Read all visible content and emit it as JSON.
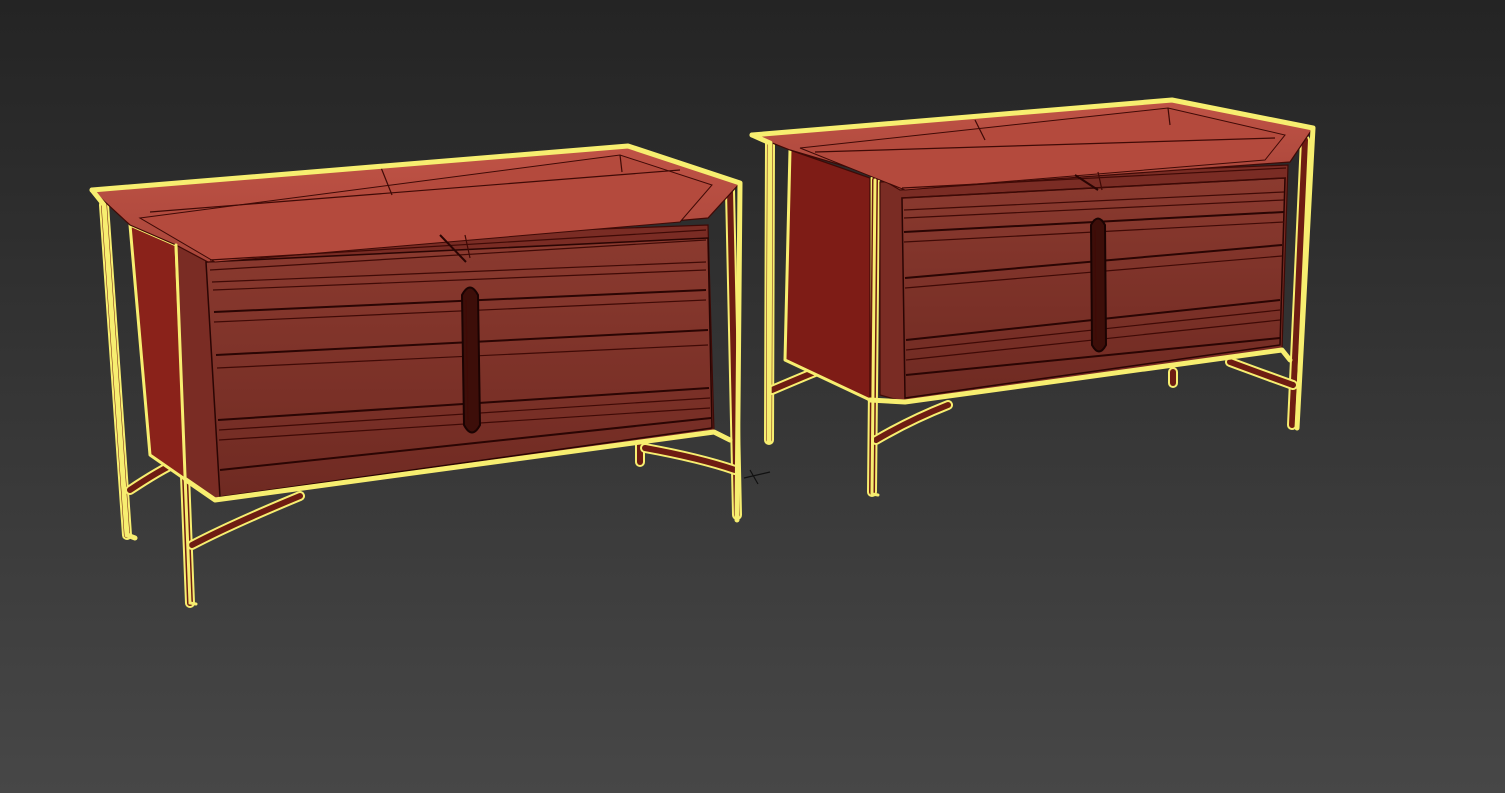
{
  "viewport": {
    "background_top": "#242424",
    "background_bottom": "#474747",
    "selection_color": "#f7ee70"
  },
  "objects": [
    {
      "kind": "sideboard",
      "state": "selected",
      "icon": "dresser-icon"
    },
    {
      "kind": "sideboard",
      "state": "selected",
      "icon": "dresser-icon"
    }
  ],
  "colors": {
    "top": "#b0463a",
    "body_front": "#80322a",
    "body_side": "#8a221a",
    "wire": "#3f0a06"
  },
  "cursor": {
    "icon": "crosshair-cursor-icon"
  }
}
